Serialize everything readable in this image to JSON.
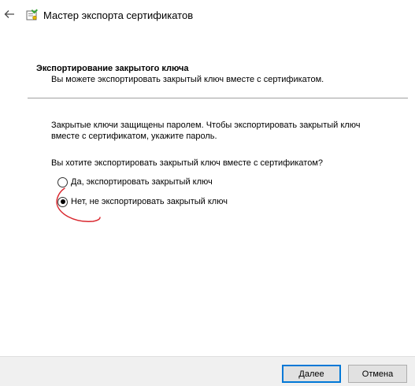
{
  "window": {
    "title": "Мастер экспорта сертификатов"
  },
  "section": {
    "heading": "Экспортирование закрытого ключа",
    "subtitle": "Вы можете экспортировать закрытый ключ вместе с сертификатом."
  },
  "body": {
    "info_line1": "Закрытые ключи защищены паролем. Чтобы экспортировать закрытый ключ",
    "info_line2": "вместе с сертификатом, укажите пароль.",
    "question": "Вы хотите экспортировать закрытый ключ вместе с сертификатом?"
  },
  "options": [
    {
      "label": "Да, экспортировать закрытый ключ",
      "selected": false
    },
    {
      "label": "Нет, не экспортировать закрытый ключ",
      "selected": true
    }
  ],
  "buttons": {
    "next": "Далее",
    "cancel": "Отмена"
  },
  "colors": {
    "annotation": "#d9262d",
    "default_button_border": "#0078d7",
    "footer_bg": "#f0f0f0"
  },
  "icons": {
    "back": "back-arrow-icon",
    "wizard": "certificate-wizard-icon"
  }
}
